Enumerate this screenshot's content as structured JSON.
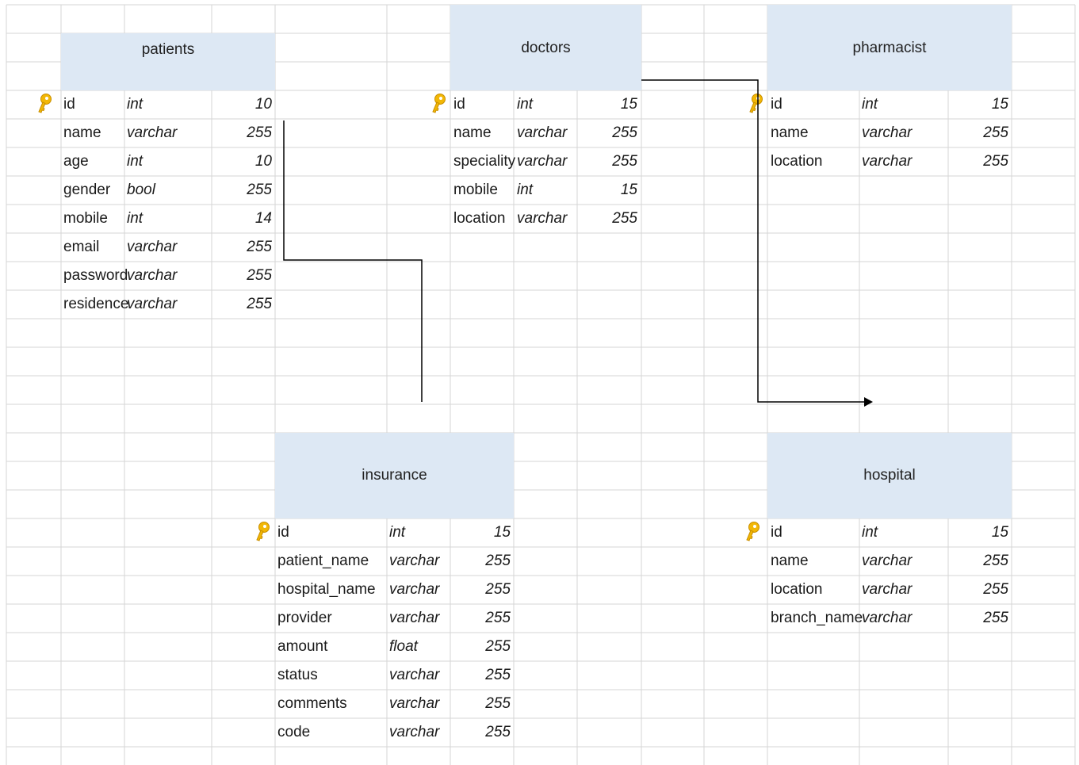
{
  "colors": {
    "header_bg": "#dde8f4",
    "grid_line": "#d6d6d6",
    "key_icon": "#f2b705",
    "connector": "#000000"
  },
  "tables": {
    "patients": {
      "title": "patients",
      "rows": [
        {
          "name": "id",
          "type": "int",
          "len": "10"
        },
        {
          "name": "name",
          "type": "varchar",
          "len": "255"
        },
        {
          "name": "age",
          "type": "int",
          "len": "10"
        },
        {
          "name": "gender",
          "type": "bool",
          "len": "255"
        },
        {
          "name": "mobile",
          "type": "int",
          "len": "14"
        },
        {
          "name": "email",
          "type": "varchar",
          "len": "255"
        },
        {
          "name": "password",
          "type": "varchar",
          "len": "255"
        },
        {
          "name": "residence",
          "type": "varchar",
          "len": "255"
        }
      ]
    },
    "doctors": {
      "title": "doctors",
      "rows": [
        {
          "name": "id",
          "type": "int",
          "len": "15"
        },
        {
          "name": "name",
          "type": "varchar",
          "len": "255"
        },
        {
          "name": "speciality",
          "type": "varchar",
          "len": "255"
        },
        {
          "name": "mobile",
          "type": "int",
          "len": "15"
        },
        {
          "name": "location",
          "type": "varchar",
          "len": "255"
        }
      ]
    },
    "pharmacist": {
      "title": "pharmacist",
      "rows": [
        {
          "name": "id",
          "type": "int",
          "len": "15"
        },
        {
          "name": "name",
          "type": "varchar",
          "len": "255"
        },
        {
          "name": "location",
          "type": "varchar",
          "len": "255"
        }
      ]
    },
    "insurance": {
      "title": "insurance",
      "rows": [
        {
          "name": "id",
          "type": "int",
          "len": "15"
        },
        {
          "name": "patient_name",
          "type": "varchar",
          "len": "255"
        },
        {
          "name": "hospital_name",
          "type": "varchar",
          "len": "255"
        },
        {
          "name": "provider",
          "type": "varchar",
          "len": "255"
        },
        {
          "name": "amount",
          "type": "float",
          "len": "255"
        },
        {
          "name": "status",
          "type": "varchar",
          "len": "255"
        },
        {
          "name": "comments",
          "type": "varchar",
          "len": "255"
        },
        {
          "name": "code",
          "type": "varchar",
          "len": "255"
        }
      ]
    },
    "hospital": {
      "title": "hospital",
      "rows": [
        {
          "name": "id",
          "type": "int",
          "len": "15"
        },
        {
          "name": "name",
          "type": "varchar",
          "len": "255"
        },
        {
          "name": "location",
          "type": "varchar",
          "len": "255"
        },
        {
          "name": "branch_name",
          "type": "varchar",
          "len": "255"
        }
      ]
    }
  }
}
